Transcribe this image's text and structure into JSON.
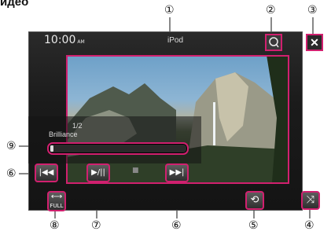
{
  "heading": "идео",
  "status_bar": {
    "time": "10:00",
    "ampm": "AM",
    "source": "iPod"
  },
  "overlay": {
    "track": "1/2",
    "setting_label": "Brilliance"
  },
  "icons": {
    "search": "search-icon",
    "close": "close-icon",
    "prev": "skip-back-icon",
    "play_pause": "play-pause-icon",
    "next": "skip-forward-icon",
    "repeat": "repeat-icon",
    "shuffle": "shuffle-icon",
    "wide": "wide-mode-icon"
  },
  "buttons": {
    "prev_glyph": "|◀◀",
    "play_pause_glyph": "▶/||",
    "next_glyph": "▶▶|",
    "repeat_glyph": "⟲",
    "shuffle_glyph": "⤨",
    "close_glyph": "✕",
    "wide_label": "FULL",
    "wide_glyph": "⟷"
  },
  "callouts": {
    "c1": "①",
    "c2": "②",
    "c3": "③",
    "c4": "④",
    "c5": "⑤",
    "c6a": "⑥",
    "c6b": "⑥",
    "c7": "⑦",
    "c8": "⑧",
    "c9": "⑨"
  },
  "colors": {
    "highlight": "#d1206f",
    "screen_bg": "#1b1b1b"
  }
}
